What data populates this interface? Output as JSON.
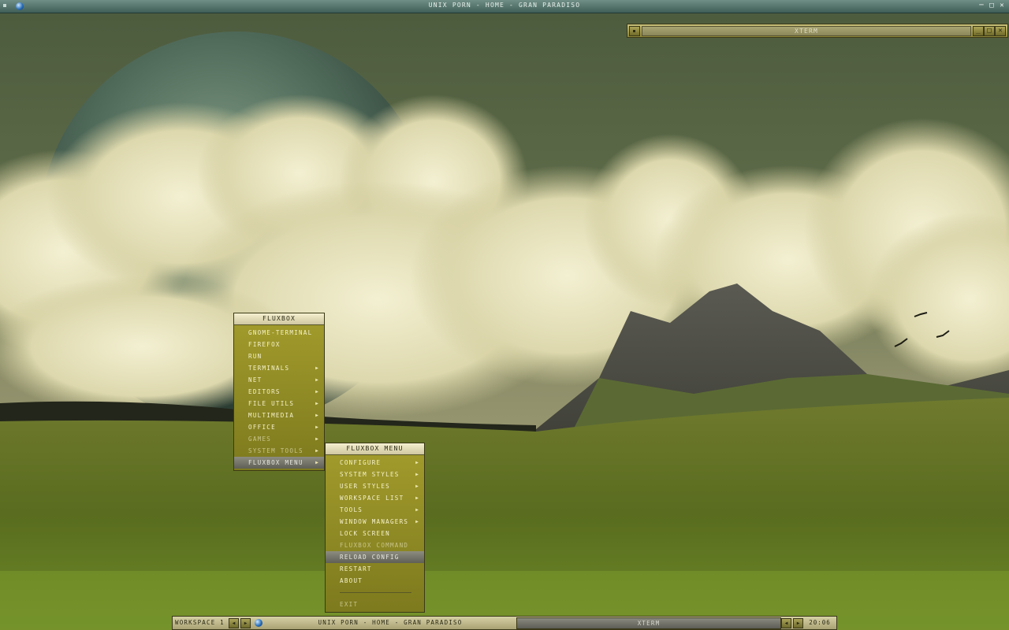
{
  "window": {
    "title": "UNIX PORN - HOME - GRAN PARADISO"
  },
  "xterm": {
    "title": "XTERM"
  },
  "root_menu": {
    "title": "FLUXBOX",
    "items": [
      {
        "label": "GNOME-TERMINAL",
        "submenu": false
      },
      {
        "label": "FIREFOX",
        "submenu": false
      },
      {
        "label": "RUN",
        "submenu": false
      },
      {
        "label": "TERMINALS",
        "submenu": true
      },
      {
        "label": "NET",
        "submenu": true
      },
      {
        "label": "EDITORS",
        "submenu": true
      },
      {
        "label": "FILE UTILS",
        "submenu": true
      },
      {
        "label": "MULTIMEDIA",
        "submenu": true
      },
      {
        "label": "OFFICE",
        "submenu": true
      },
      {
        "label": "GAMES",
        "submenu": true
      },
      {
        "label": "SYSTEM TOOLS",
        "submenu": true
      },
      {
        "label": "FLUXBOX MENU",
        "submenu": true,
        "selected": true
      }
    ]
  },
  "fluxbox_menu": {
    "title": "FLUXBOX MENU",
    "items": [
      {
        "label": "CONFIGURE",
        "submenu": true
      },
      {
        "label": "SYSTEM STYLES",
        "submenu": true
      },
      {
        "label": "USER STYLES",
        "submenu": true
      },
      {
        "label": "WORKSPACE LIST",
        "submenu": true
      },
      {
        "label": "TOOLS",
        "submenu": true
      },
      {
        "label": "WINDOW MANAGERS",
        "submenu": true
      },
      {
        "label": "LOCK SCREEN",
        "submenu": false
      },
      {
        "label": "FLUXBOX COMMAND",
        "submenu": false
      },
      {
        "label": "RELOAD CONFIG",
        "submenu": false,
        "selected": true
      },
      {
        "label": "RESTART",
        "submenu": false
      },
      {
        "label": "ABOUT",
        "submenu": false
      },
      {
        "label": "EXIT",
        "submenu": false,
        "after_separator": true
      }
    ]
  },
  "toolbar": {
    "workspace": "WORKSPACE 1",
    "task_active": "UNIX PORN - HOME - GRAN PARADISO",
    "task_other": "XTERM",
    "clock": "20:06"
  },
  "icons": {
    "app_icon": "globe-icon",
    "minimize": "minimize-icon",
    "maximize": "maximize-icon",
    "close": "close-icon",
    "prev": "arrow-left-icon",
    "next": "arrow-right-icon",
    "submenu": "triangle-right-icon"
  },
  "colors": {
    "menu_bg": "#8f8a26",
    "menu_title": "#e4ddb8",
    "selection": "#6e6e66",
    "titlebar": "#577a72"
  }
}
